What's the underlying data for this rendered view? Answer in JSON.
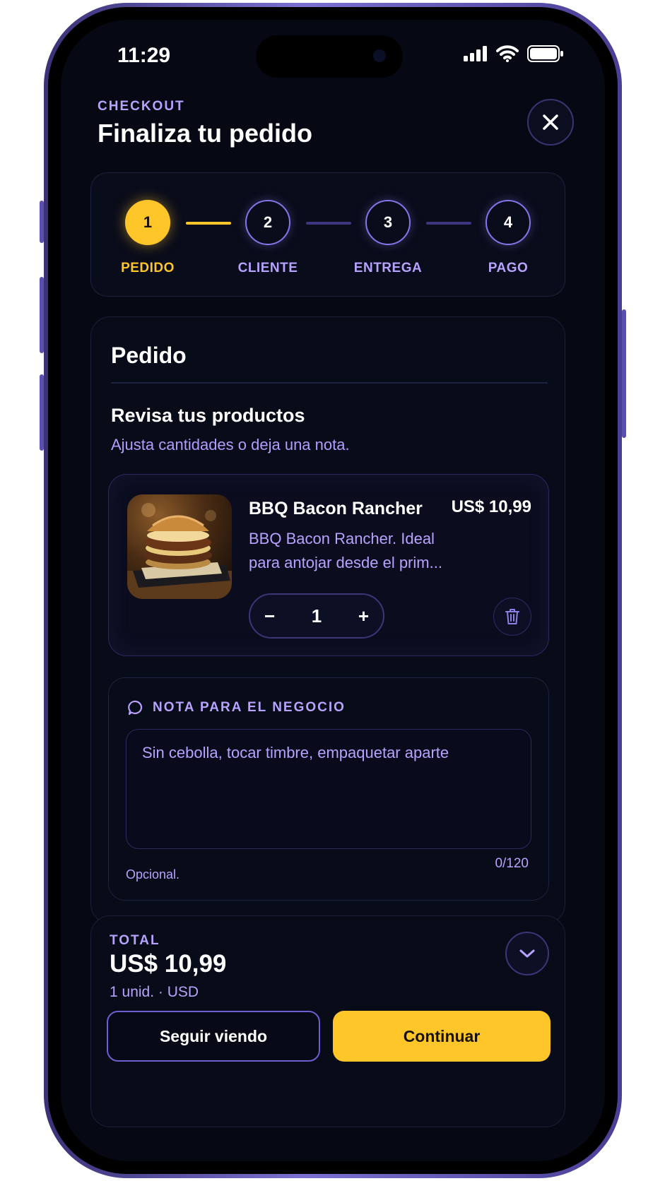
{
  "status_bar": {
    "time": "11:29"
  },
  "header": {
    "eyebrow": "CHECKOUT",
    "title": "Finaliza tu pedido"
  },
  "stepper": {
    "steps": [
      {
        "number": "1",
        "label": "PEDIDO",
        "active": true
      },
      {
        "number": "2",
        "label": "CLIENTE",
        "active": false
      },
      {
        "number": "3",
        "label": "ENTREGA",
        "active": false
      },
      {
        "number": "4",
        "label": "PAGO",
        "active": false
      }
    ]
  },
  "order": {
    "section_title": "Pedido",
    "subtitle": "Revisa tus productos",
    "description": "Ajusta cantidades o deja una nota.",
    "product": {
      "name": "BBQ Bacon Rancher",
      "price": "US$ 10,99",
      "description": "BBQ Bacon Rancher. Ideal para antojar desde el prim...",
      "quantity": "1",
      "minus": "−",
      "plus": "+"
    },
    "note": {
      "label": "NOTA PARA EL NEGOCIO",
      "placeholder": "Sin cebolla, tocar timbre, empaquetar aparte",
      "counter": "0/120",
      "hint": "Opcional."
    }
  },
  "footer": {
    "total_label": "TOTAL",
    "total_value": "US$ 10,99",
    "total_meta": "1 unid. · USD",
    "secondary_button": "Seguir viendo",
    "primary_button": "Continuar"
  },
  "colors": {
    "accent": "#ffc62a",
    "purple_text": "#b7a3ff",
    "background": "#060914",
    "phone_frame": "#7b6fd1"
  },
  "icons": [
    "close-icon",
    "chat-bubble-icon",
    "trash-icon",
    "chevron-down-icon",
    "wifi-icon",
    "signal-icon",
    "battery-icon"
  ]
}
